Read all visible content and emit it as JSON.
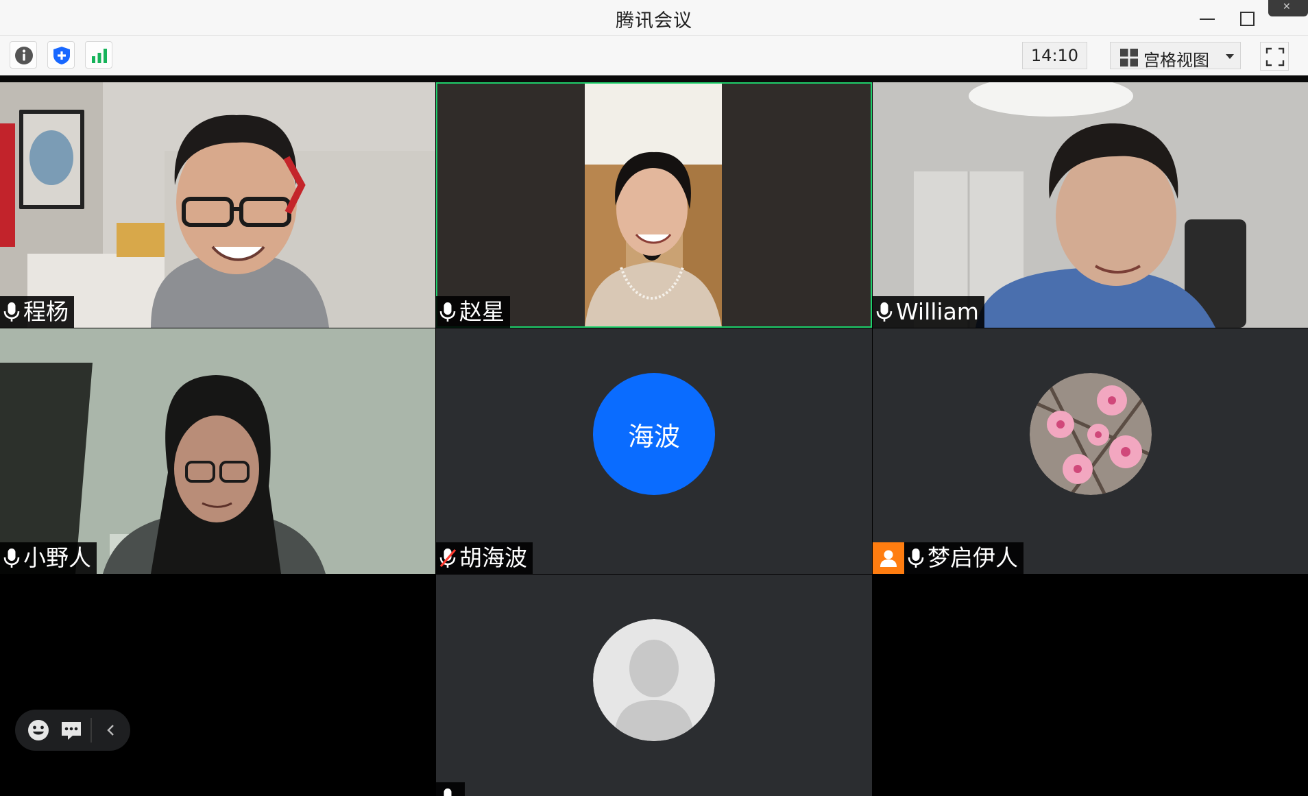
{
  "app": {
    "title": "腾讯会议"
  },
  "toolbar": {
    "timer": "14:10",
    "view_mode": "宫格视图",
    "icons": [
      "info-icon",
      "shield-icon",
      "signal-icon",
      "grid-view-icon",
      "fullscreen-icon"
    ]
  },
  "colors": {
    "active_speaker_border": "#1ed06b",
    "initials_avatar": "#0a6cff",
    "host_badge": "#ff7d10",
    "muted_icon": "#ff3b30"
  },
  "participants": [
    {
      "name": "程杨",
      "mic": "on",
      "video": true
    },
    {
      "name": "赵星",
      "mic": "on",
      "video": true,
      "active_speaker": true
    },
    {
      "name": "William",
      "mic": "on",
      "video": true
    },
    {
      "name": "小野人",
      "mic": "on",
      "video": true
    },
    {
      "name": "胡海波",
      "mic": "muted",
      "video": false,
      "avatar_initials": "海波"
    },
    {
      "name": "梦启伊人",
      "mic": "on",
      "video": false,
      "avatar": "peach-blossom-photo",
      "host": true
    },
    {
      "name": "",
      "mic": "on",
      "video": false,
      "avatar": "default-person-icon"
    }
  ],
  "floating_bar": {
    "icons": [
      "emoji-icon",
      "chat-icon",
      "collapse-chevron-icon"
    ]
  }
}
